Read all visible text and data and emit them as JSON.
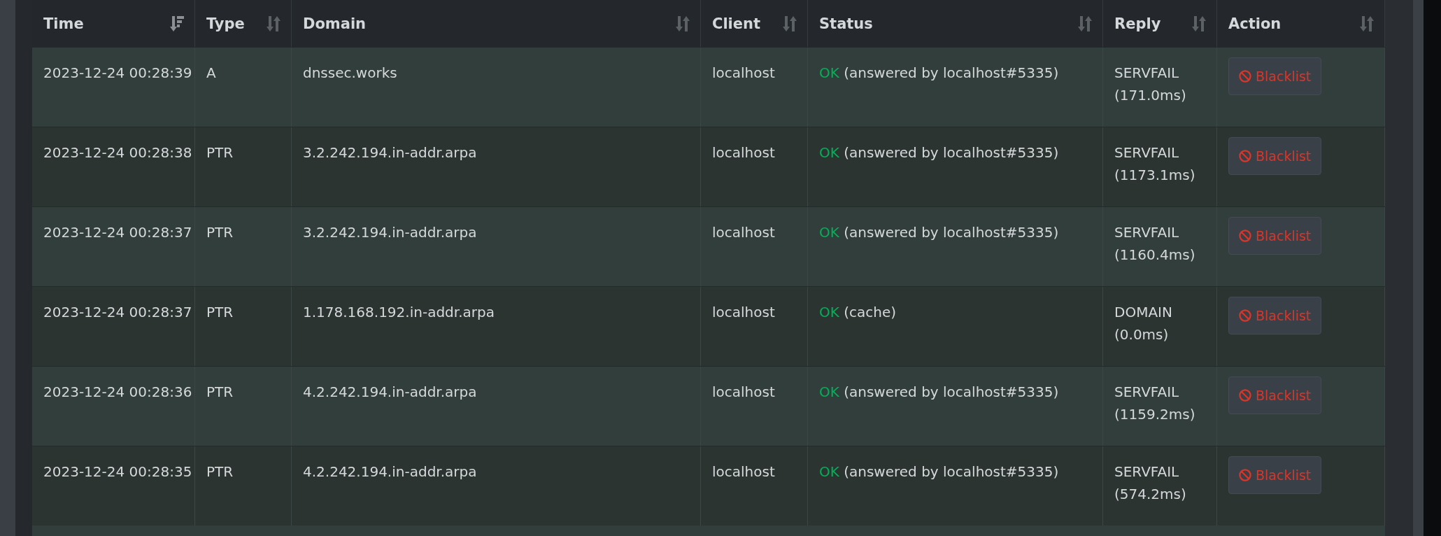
{
  "table": {
    "columns": [
      {
        "label": "Time",
        "sorted": true
      },
      {
        "label": "Type",
        "sorted": false
      },
      {
        "label": "Domain",
        "sorted": false
      },
      {
        "label": "Client",
        "sorted": false
      },
      {
        "label": "Status",
        "sorted": false
      },
      {
        "label": "Reply",
        "sorted": false
      },
      {
        "label": "Action",
        "sorted": false
      }
    ],
    "rows": [
      {
        "time": "2023-12-24 00:28:39",
        "type": "A",
        "domain": "dnssec.works",
        "client": "localhost",
        "status_code": "OK",
        "status_detail": "(answered by localhost#5335)",
        "reply": "SERVFAIL",
        "reply_time": "(171.0ms)",
        "action": "Blacklist"
      },
      {
        "time": "2023-12-24 00:28:38",
        "type": "PTR",
        "domain": "3.2.242.194.in-addr.arpa",
        "client": "localhost",
        "status_code": "OK",
        "status_detail": "(answered by localhost#5335)",
        "reply": "SERVFAIL",
        "reply_time": "(1173.1ms)",
        "action": "Blacklist"
      },
      {
        "time": "2023-12-24 00:28:37",
        "type": "PTR",
        "domain": "3.2.242.194.in-addr.arpa",
        "client": "localhost",
        "status_code": "OK",
        "status_detail": "(answered by localhost#5335)",
        "reply": "SERVFAIL",
        "reply_time": "(1160.4ms)",
        "action": "Blacklist"
      },
      {
        "time": "2023-12-24 00:28:37",
        "type": "PTR",
        "domain": "1.178.168.192.in-addr.arpa",
        "client": "localhost",
        "status_code": "OK",
        "status_detail": "(cache)",
        "reply": "DOMAIN",
        "reply_time": "(0.0ms)",
        "action": "Blacklist"
      },
      {
        "time": "2023-12-24 00:28:36",
        "type": "PTR",
        "domain": "4.2.242.194.in-addr.arpa",
        "client": "localhost",
        "status_code": "OK",
        "status_detail": "(answered by localhost#5335)",
        "reply": "SERVFAIL",
        "reply_time": "(1159.2ms)",
        "action": "Blacklist"
      },
      {
        "time": "2023-12-24 00:28:35",
        "type": "PTR",
        "domain": "4.2.242.194.in-addr.arpa",
        "client": "localhost",
        "status_code": "OK",
        "status_detail": "(answered by localhost#5335)",
        "reply": "SERVFAIL",
        "reply_time": "(574.2ms)",
        "action": "Blacklist"
      }
    ]
  }
}
